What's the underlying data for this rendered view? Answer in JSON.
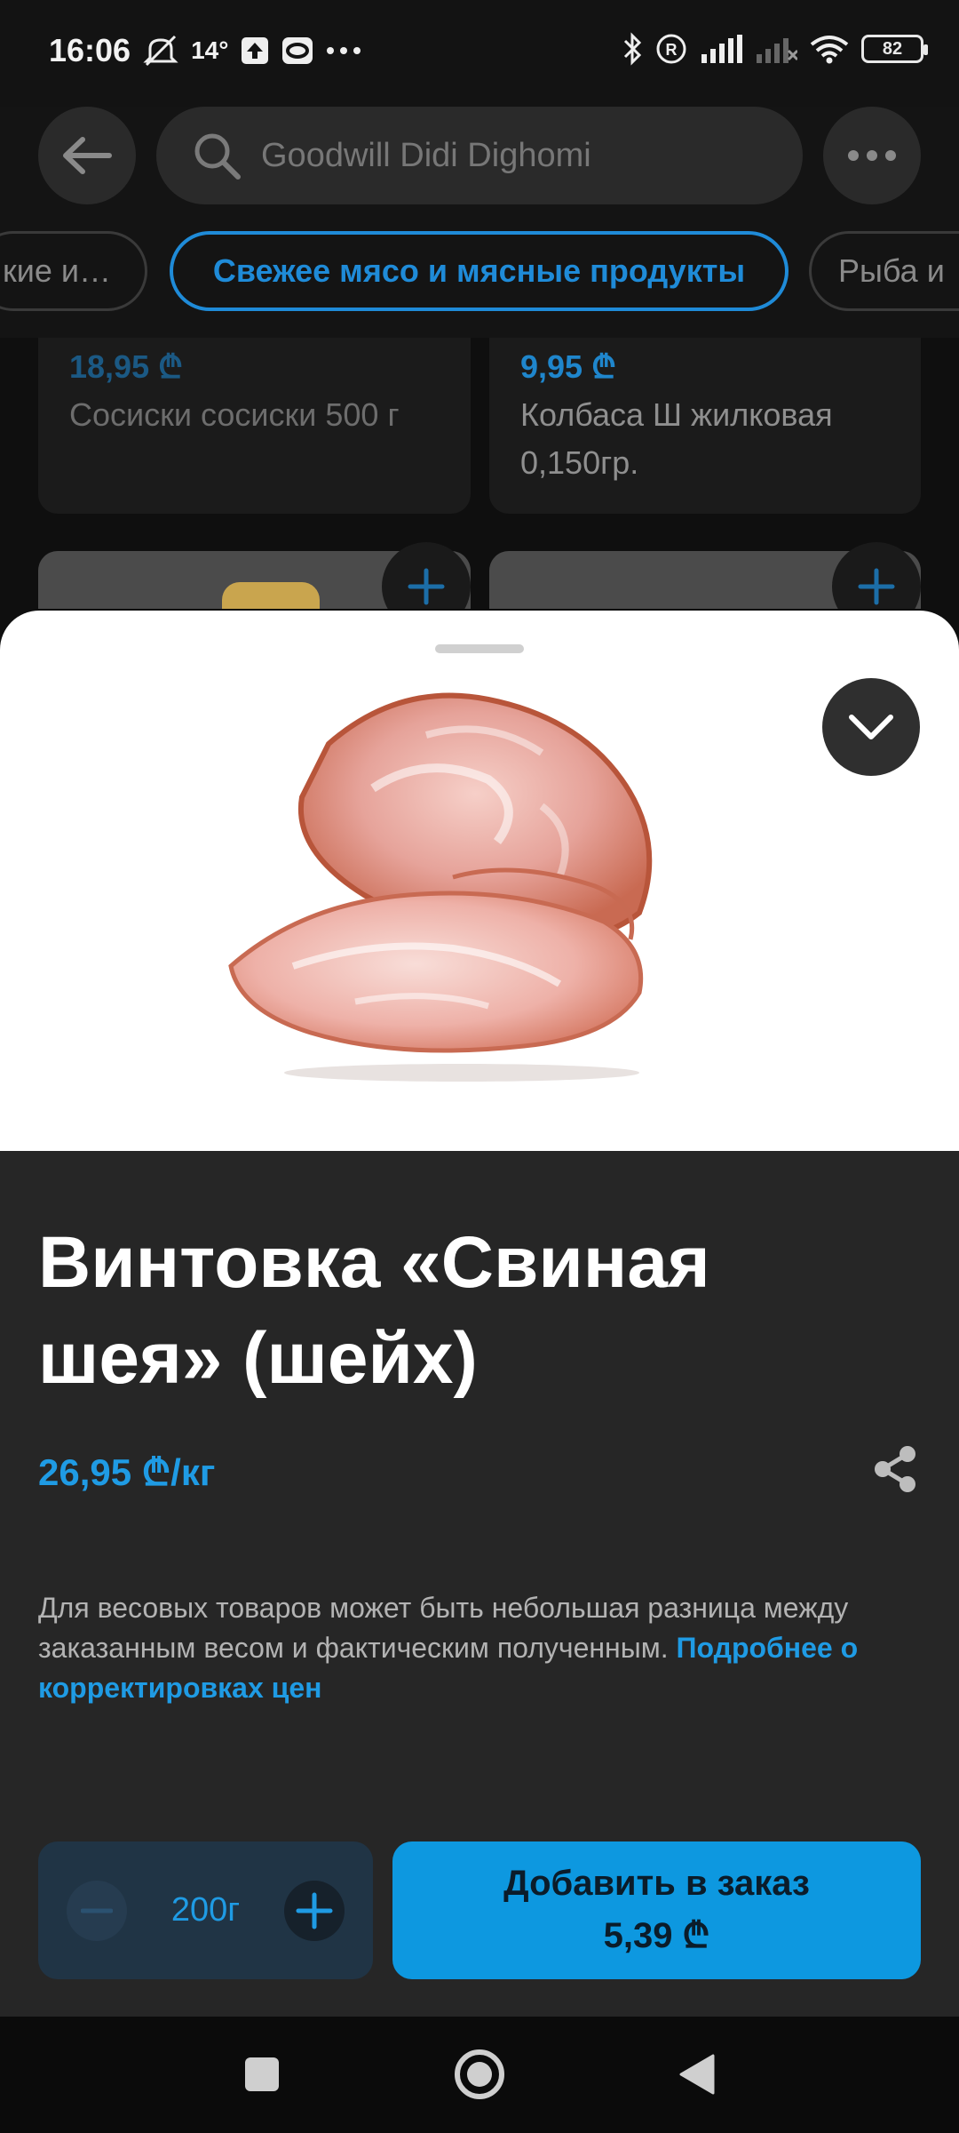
{
  "status_bar": {
    "time": "16:06",
    "temperature": "14°",
    "battery": "82",
    "icons": [
      "mute-icon",
      "upload-icon",
      "app-icon",
      "more-dots-icon",
      "bluetooth-icon",
      "registered-icon",
      "signal-icon",
      "signal-weak-icon",
      "wifi-icon",
      "battery-icon"
    ]
  },
  "header": {
    "search_text": "Goodwill Didi Dighomi",
    "categories": [
      {
        "label": "кие и…",
        "active": false
      },
      {
        "label": "Свежее мясо и мясные продукты",
        "active": true
      },
      {
        "label": "Рыба и",
        "active": false
      }
    ]
  },
  "background_products": [
    {
      "price": "18,95 ₾",
      "name": "Сосиски сосиски 500 г"
    },
    {
      "price": "9,95 ₾",
      "name": "Колбаса Ш жилковая 0,150гр."
    }
  ],
  "product": {
    "title": "Винтовка «Свиная шея» (шейх)",
    "price": "26,95 ₾/кг",
    "note_text": "Для весовых товаров может быть небольшая разница между заказанным весом и фактическим полученным.",
    "note_link": "Подробнее о корректировках цен",
    "quantity": "200г",
    "add_button_label": "Добавить в заказ",
    "add_button_price": "5,39 ₾"
  },
  "colors": {
    "accent": "#1f9be4",
    "button": "#0d98e0",
    "sheet_background": "#262626"
  }
}
